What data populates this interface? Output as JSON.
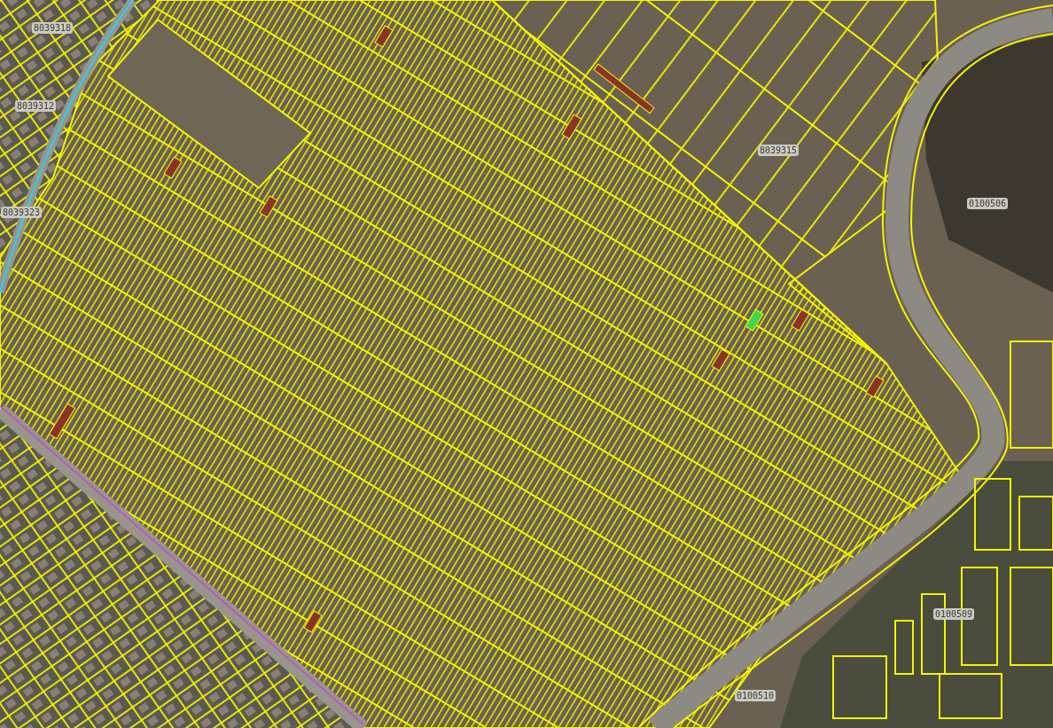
{
  "map": {
    "parcel_labels": [
      "8039318",
      "8039312",
      "8039323",
      "8039315",
      "0100506",
      "0100509",
      "0100510"
    ]
  }
}
